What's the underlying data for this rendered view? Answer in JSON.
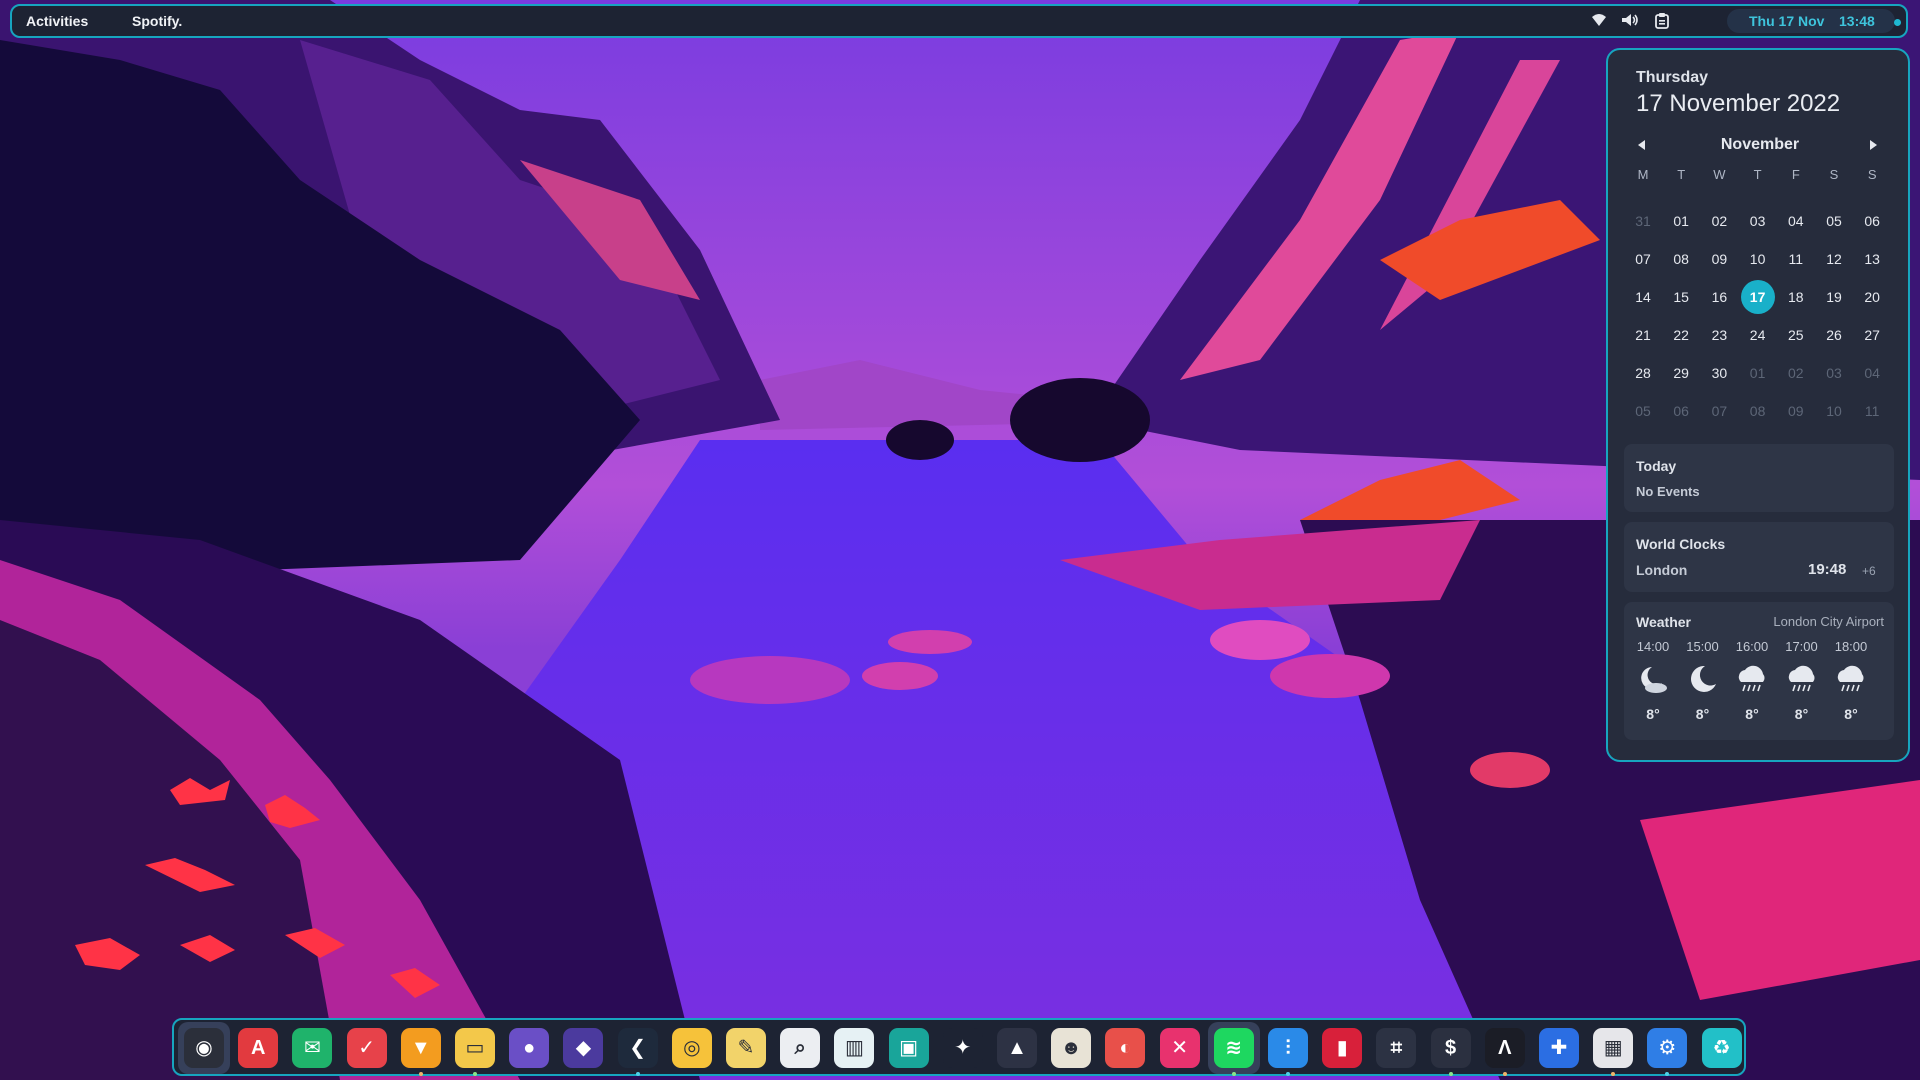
{
  "topbar": {
    "activities_label": "Activities",
    "app_label": "Spotify.",
    "clock_date": "Thu 17 Nov",
    "clock_time": "13:48"
  },
  "calendar": {
    "weekday": "Thursday",
    "full_date": "17 November 2022",
    "month": "November",
    "day_headers": [
      "M",
      "T",
      "W",
      "T",
      "F",
      "S",
      "S"
    ],
    "weeks": [
      [
        "31",
        "01",
        "02",
        "03",
        "04",
        "05",
        "06"
      ],
      [
        "07",
        "08",
        "09",
        "10",
        "11",
        "12",
        "13"
      ],
      [
        "14",
        "15",
        "16",
        "17",
        "18",
        "19",
        "20"
      ],
      [
        "21",
        "22",
        "23",
        "24",
        "25",
        "26",
        "27"
      ],
      [
        "28",
        "29",
        "30",
        "01",
        "02",
        "03",
        "04"
      ],
      [
        "05",
        "06",
        "07",
        "08",
        "09",
        "10",
        "11"
      ]
    ],
    "today": "17"
  },
  "events": {
    "title": "Today",
    "text": "No Events"
  },
  "world_clocks": {
    "title": "World Clocks",
    "city": "London",
    "time": "19:48",
    "offset": "+6"
  },
  "weather": {
    "title": "Weather",
    "location": "London City Airport",
    "forecast": [
      {
        "hour": "14:00",
        "icon": "partly-cloudy-night-icon",
        "temp": "8°"
      },
      {
        "hour": "15:00",
        "icon": "moon-icon",
        "temp": "8°"
      },
      {
        "hour": "16:00",
        "icon": "rain-cloud-icon",
        "temp": "8°"
      },
      {
        "hour": "17:00",
        "icon": "rain-cloud-icon",
        "temp": "8°"
      },
      {
        "hour": "18:00",
        "icon": "rain-cloud-icon",
        "temp": "8°"
      }
    ]
  },
  "dock": {
    "apps": [
      {
        "name": "eye-app-icon",
        "color": "#2b2f3a",
        "glyph": "◉"
      },
      {
        "name": "app-store-icon",
        "color": "#e23a3f",
        "glyph": "A"
      },
      {
        "name": "mail-icon",
        "color": "#1fb36b",
        "glyph": "✉"
      },
      {
        "name": "todo-icon",
        "color": "#e7424a",
        "glyph": "✓"
      },
      {
        "name": "brave-browser-icon",
        "color": "#f39c1f",
        "glyph": "▼"
      },
      {
        "name": "files-icon",
        "color": "#f3c84a",
        "glyph": "▭"
      },
      {
        "name": "github-icon",
        "color": "#6a4fc6",
        "glyph": "●"
      },
      {
        "name": "obsidian-icon",
        "color": "#4b3a9e",
        "glyph": "◆"
      },
      {
        "name": "vscode-icon",
        "color": "#1e2a3c",
        "glyph": "❮"
      },
      {
        "name": "chrome-icon",
        "color": "#f6c23a",
        "glyph": "◎"
      },
      {
        "name": "text-editor-icon",
        "color": "#f2d36a",
        "glyph": "✎"
      },
      {
        "name": "search-icon",
        "color": "#eceef2",
        "glyph": "⌕"
      },
      {
        "name": "books-icon",
        "color": "#e6f1f4",
        "glyph": "▥"
      },
      {
        "name": "screenshot-icon",
        "color": "#19a59a",
        "glyph": "▣"
      },
      {
        "name": "figma-icon",
        "color": "#1d2333",
        "glyph": "✦"
      },
      {
        "name": "inkscape-icon",
        "color": "#2d3244",
        "glyph": "▲"
      },
      {
        "name": "gimp-icon",
        "color": "#e8e3d6",
        "glyph": "☻"
      },
      {
        "name": "color-picker-icon",
        "color": "#e8504a",
        "glyph": "◐"
      },
      {
        "name": "video-app-icon",
        "color": "#e8326e",
        "glyph": "✕"
      },
      {
        "name": "spotify-icon",
        "color": "#1ed760",
        "glyph": "≋"
      },
      {
        "name": "equalizer-icon",
        "color": "#2a8ae8",
        "glyph": "⫶"
      },
      {
        "name": "audio-visualizer-icon",
        "color": "#d8203a",
        "glyph": "▮"
      },
      {
        "name": "screen-crop-icon",
        "color": "#2c3243",
        "glyph": "⌗"
      },
      {
        "name": "terminal-icon",
        "color": "#2b3040",
        "glyph": "$"
      },
      {
        "name": "alacritty-icon",
        "color": "#1b1d26",
        "glyph": "Λ"
      },
      {
        "name": "extensions-icon",
        "color": "#2b6ee3",
        "glyph": "✚"
      },
      {
        "name": "settings-tweaks-icon",
        "color": "#e6e6ea",
        "glyph": "▦"
      },
      {
        "name": "settings-icon",
        "color": "#2f7ee6",
        "glyph": "⚙"
      },
      {
        "name": "trash-icon",
        "color": "#22c0c8",
        "glyph": "♻"
      }
    ]
  }
}
